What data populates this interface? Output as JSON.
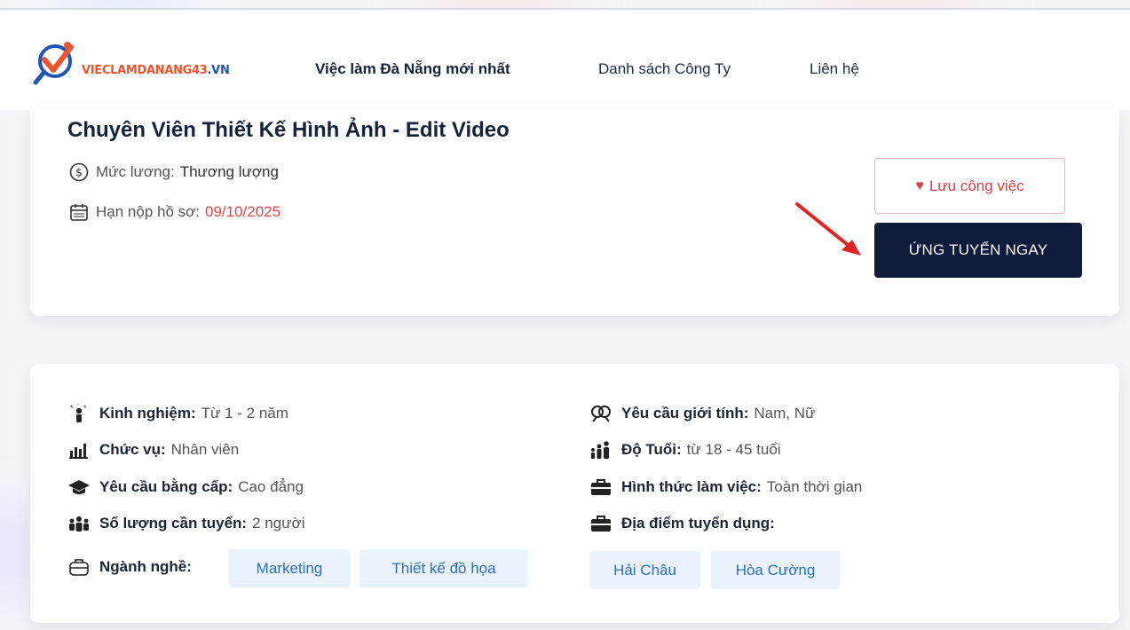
{
  "brand": {
    "logo_main": "VIECLAMDANANG43",
    "logo_tld": ".VN"
  },
  "nav": {
    "items": [
      "Việc làm Đà Nẵng mới nhất",
      "Danh sách Công Ty",
      "Liên hệ"
    ]
  },
  "job": {
    "title": "Chuyên Viên Thiết Kế Hình Ảnh - Edit Video",
    "salary_label": "Mức lương:",
    "salary_value": "Thương lượng",
    "deadline_label": "Hạn nộp hồ sơ:",
    "deadline_value": "09/10/2025"
  },
  "actions": {
    "save_label": "Lưu công việc",
    "apply_label": "ỨNG TUYỂN NGAY"
  },
  "details": {
    "experience_label": "Kinh nghiệm:",
    "experience_value": "Từ 1 - 2 năm",
    "position_label": "Chức vụ:",
    "position_value": "Nhân viên",
    "degree_label": "Yêu cầu bằng cấp:",
    "degree_value": "Cao đẳng",
    "quantity_label": "Số lượng cần tuyển:",
    "quantity_value": "2 người",
    "industry_label": "Ngành nghề:",
    "industry_tags": [
      "Marketing",
      "Thiết kế đồ họa"
    ],
    "gender_label": "Yêu cầu giới tính:",
    "gender_value": "Nam, Nữ",
    "age_label": "Độ Tuổi:",
    "age_value": "từ 18 - 45 tuổi",
    "worktype_label": "Hình thức làm việc:",
    "worktype_value": "Toàn thời gian",
    "location_label": "Địa điểm tuyển dụng:",
    "location_tags": [
      "Hải Châu",
      "Hòa Cường"
    ]
  },
  "colors": {
    "primary_dark": "#0f1b3d",
    "accent_red": "#d9404a",
    "tag_bg": "#eaf3fb",
    "tag_text": "#2d6fb8",
    "logo_orange": "#f0542c",
    "logo_blue": "#1e56b5"
  }
}
